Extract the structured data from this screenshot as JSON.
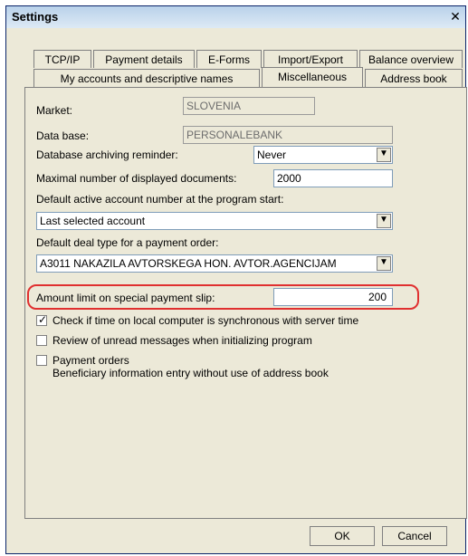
{
  "window": {
    "title": "Settings",
    "close_glyph": "✕"
  },
  "tabs_row1": [
    "TCP/IP",
    "Payment details",
    "E-Forms",
    "Import/Export",
    "Balance overview"
  ],
  "tabs_row2": [
    "My accounts and descriptive names",
    "Miscellaneous",
    "Address book"
  ],
  "active_tab": "Miscellaneous",
  "fields": {
    "market_label": "Market:",
    "market_value": "SLOVENIA",
    "database_label": "Data base:",
    "database_value": "PERSONALEBANK",
    "db_archiving_label": "Database archiving reminder:",
    "db_archiving_value": "Never",
    "max_docs_label": "Maximal number of displayed documents:",
    "max_docs_value": "2000",
    "default_account_label": "Default active account number at the program start:",
    "default_account_value": "Last selected account",
    "default_deal_label": "Default deal type for a payment order:",
    "default_deal_value": "A3011 NAKAZILA AVTORSKEGA HON. AVTOR.AGENCIJAM",
    "amount_limit_label": "Amount limit on special payment slip:",
    "amount_limit_value": "200"
  },
  "checkboxes": [
    {
      "label": "Check if time on local computer is synchronous with server time",
      "checked": true
    },
    {
      "label": "Review of unread messages when initializing program",
      "checked": false
    },
    {
      "label": "Payment orders",
      "sublabel": "Beneficiary information entry without use of address book",
      "checked": false
    }
  ],
  "buttons": {
    "ok": "OK",
    "cancel": "Cancel"
  }
}
